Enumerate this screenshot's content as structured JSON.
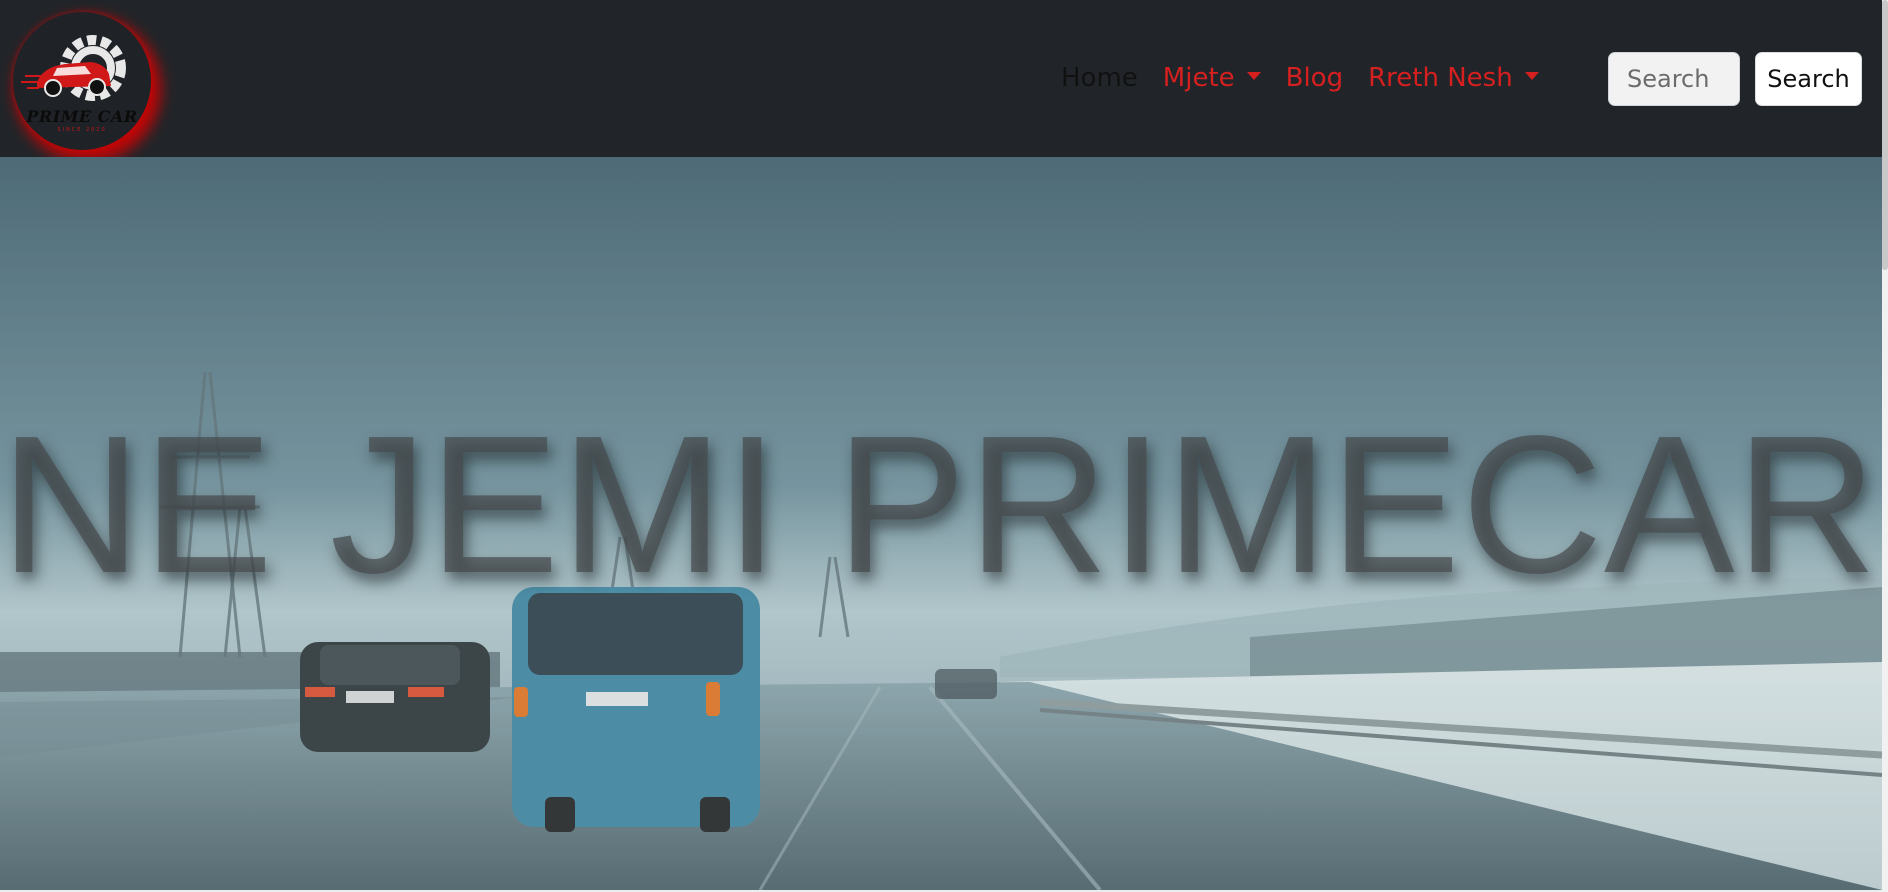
{
  "logo": {
    "brand": "PRIME CAR",
    "tagline": "SINCE 2020"
  },
  "nav": {
    "home": "Home",
    "tools": "Mjete",
    "blog": "Blog",
    "about": "Rreth Nesh"
  },
  "search": {
    "placeholder": "Search",
    "button_label": "Search"
  },
  "hero": {
    "title": "NE JEMI PRIMECAR"
  },
  "colors": {
    "navbar": "#212529",
    "accent": "#d61f1f",
    "hero_fog": "#4f6f7d"
  }
}
